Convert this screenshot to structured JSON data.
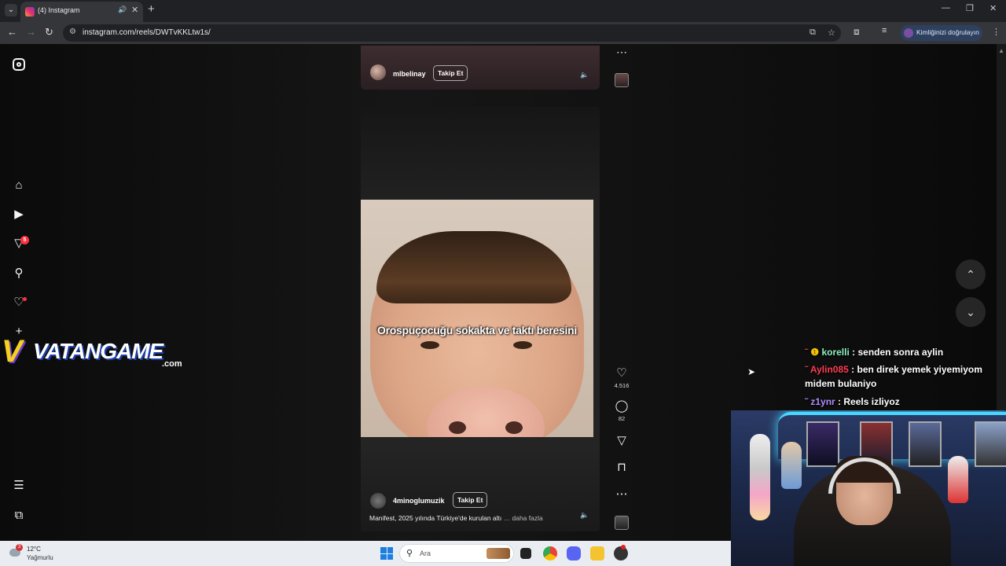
{
  "browser": {
    "tab_title": "(4) Instagram",
    "url": "instagram.com/reels/DWTvKKLtw1s/",
    "profile_label": "Kimliğinizi doğrulayın",
    "tab_audio_icon": "speaker-icon",
    "new_tab_symbol": "+",
    "close_symbol": "✕"
  },
  "sidebar": {
    "notifications_badge": "5",
    "items": [
      "home",
      "reels",
      "messages",
      "search",
      "notifications",
      "create",
      "more",
      "also-from-meta"
    ]
  },
  "watermark": {
    "v": "V",
    "text": "VATANGAME",
    "com": ".com"
  },
  "reel_prev": {
    "username": "mlbelinay",
    "follow_label": "Takip Et"
  },
  "reel": {
    "caption_overlay": "Orospuçocuğu sokakta ve taktı beresini",
    "username": "4minoglumuzik",
    "follow_label": "Takip Et",
    "description": "Manifest, 2025 yılında Türkiye'de kurulan altı",
    "description_suffix": "… daha fazla",
    "likes": "4.516",
    "comments": "82"
  },
  "chat": [
    {
      "user": "korelli",
      "message": ": senden sonra aylin",
      "color": "#8ef0c0"
    },
    {
      "user": "Aylin085",
      "message": ": ben direk yemek yiyemiyom midem bulaniyo",
      "color": "#ff3b52"
    },
    {
      "user": "z1ynr",
      "message": ": Reels izliyoz",
      "color": "#b18cff"
    }
  ],
  "taskbar": {
    "temperature": "12°C",
    "weather": "Yağmurlu",
    "weather_badge": "3",
    "search_placeholder": "Ara"
  },
  "colors": {
    "accent_red": "#ff3040",
    "windows_blue": "#1b7ee0"
  }
}
